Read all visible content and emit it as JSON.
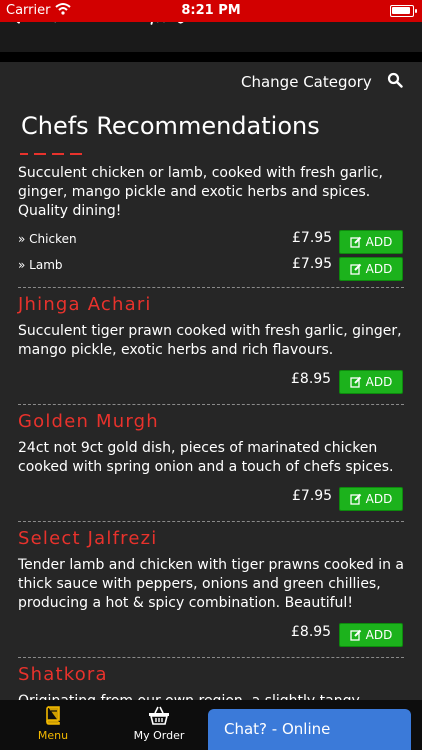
{
  "status_bar": {
    "carrier": "Carrier",
    "time": "8:21 PM"
  },
  "header": {
    "change_category": "Change Category",
    "title": "Chefs Recommendations"
  },
  "colors": {
    "status_bar": "#d20000",
    "dish_name": "#e8322c",
    "add_button": "#1cb21c",
    "active_tab": "#f2b800",
    "chat": "#3b7ad9"
  },
  "menu": {
    "partial_item": {
      "description": "Succulent chicken or lamb, cooked with fresh garlic, ginger, mango pickle and exotic herbs and spices. Quality dining!",
      "options": [
        {
          "label": "» Chicken",
          "price": "£7.95",
          "button": "ADD"
        },
        {
          "label": "» Lamb",
          "price": "£7.95",
          "button": "ADD"
        }
      ]
    },
    "items": [
      {
        "name": "Jhinga Achari",
        "description": "Succulent tiger prawn cooked with fresh garlic, ginger, mango pickle, exotic herbs and rich flavours.",
        "price": "£8.95",
        "button": "ADD"
      },
      {
        "name": "Golden Murgh",
        "description": "24ct not 9ct gold dish, pieces of marinated chicken cooked with spring onion and a touch of chefs spices.",
        "price": "£7.95",
        "button": "ADD"
      },
      {
        "name": "Select Jalfrezi",
        "description": "Tender lamb and chicken with tiger prawns cooked in a thick sauce with peppers, onions and green chillies, producing a hot & spicy combination. Beautiful!",
        "price": "£8.95",
        "button": "ADD"
      },
      {
        "name": "Shatkora",
        "description": "Originating from our own region, a slightly tangy"
      }
    ]
  },
  "tabbar": {
    "menu_label": "Menu",
    "order_label": "My Order",
    "chat_label": "Chat? - Online"
  },
  "icons": {
    "search": "search-icon",
    "edit": "edit-icon",
    "menu": "book-icon",
    "order": "basket-icon",
    "wifi": "wifi-icon",
    "battery": "battery-icon"
  }
}
